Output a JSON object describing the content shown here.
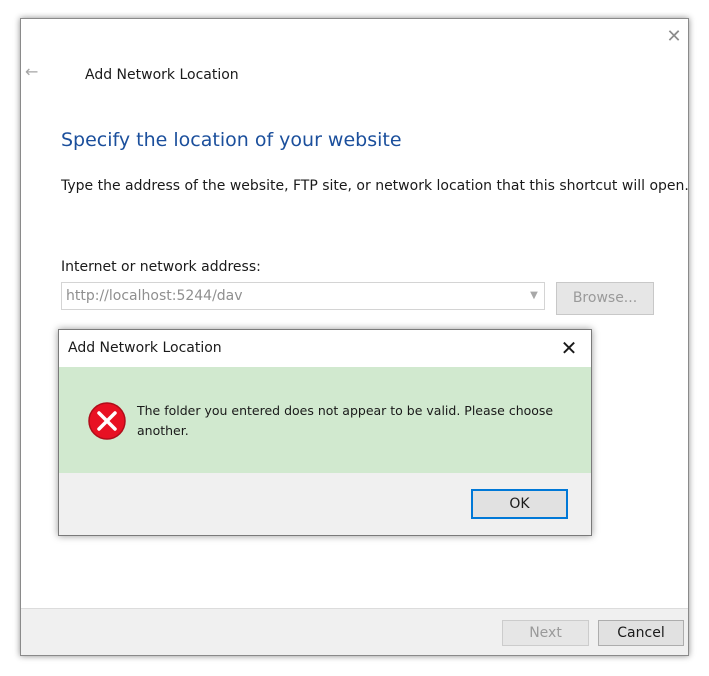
{
  "wizard": {
    "title": "Add Network Location",
    "heading": "Specify the location of your website",
    "instruction": "Type the address of the website, FTP site, or network location that this shortcut will open.",
    "address_label": "Internet or network address:",
    "address_value": "http://localhost:5244/dav",
    "browse_label": "Browse...",
    "next_label": "Next",
    "cancel_label": "Cancel",
    "icons": {
      "back": "back-arrow-icon",
      "close": "close-icon",
      "dropdown": "chevron-down-icon"
    }
  },
  "dialog": {
    "title": "Add Network Location",
    "message": "The folder you entered does not appear to be valid.  Please choose another.",
    "ok_label": "OK",
    "icons": {
      "error": "error-icon",
      "close": "close-icon"
    }
  },
  "colors": {
    "heading": "#1b4f9c",
    "dialog_body_bg": "#d1e9cf",
    "error_red": "#e81123",
    "focus_border": "#0078d7"
  }
}
